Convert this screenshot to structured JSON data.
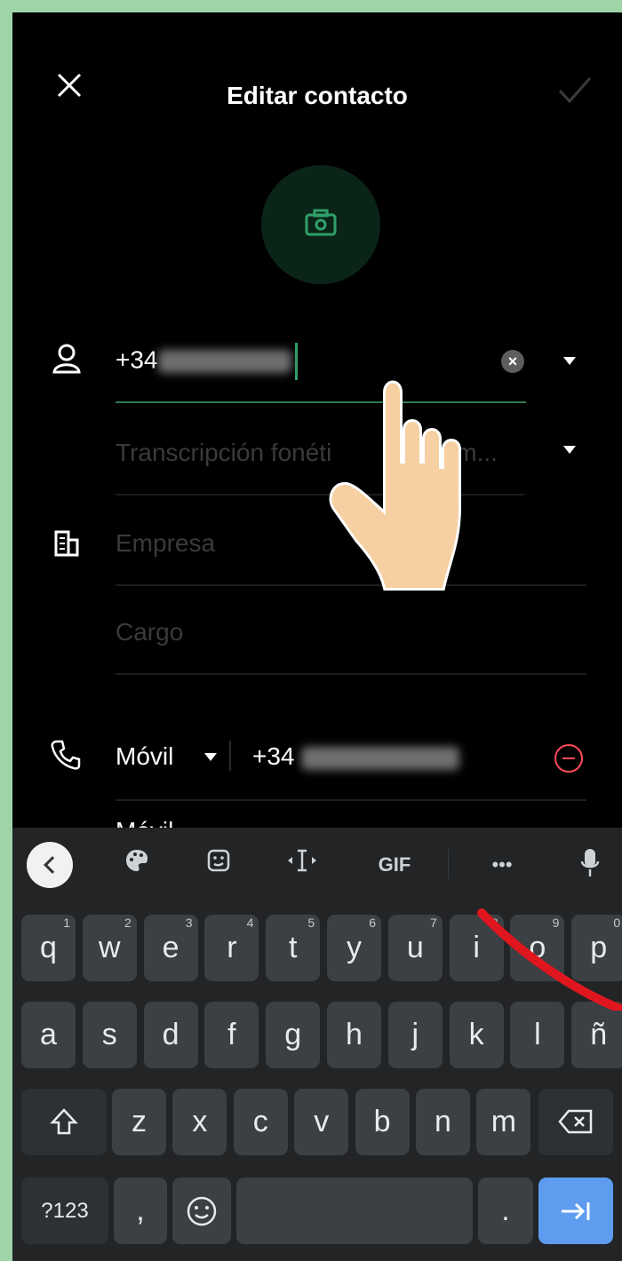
{
  "header": {
    "title": "Editar contacto"
  },
  "contact": {
    "name_prefix": "+34",
    "phonetic_placeholder": "Transcripción fonética del nombre",
    "phonetic_display": "Transcripción fonéti",
    "phonetic_tail": "m...",
    "company_placeholder": "Empresa",
    "job_placeholder": "Cargo",
    "phone_type": "Móvil",
    "phone_prefix": "+34",
    "next_row_label": "Móvil"
  },
  "keyboard": {
    "toolbar": {
      "gif": "GIF",
      "more": "•••"
    },
    "row1": [
      {
        "k": "q",
        "h": "1"
      },
      {
        "k": "w",
        "h": "2"
      },
      {
        "k": "e",
        "h": "3"
      },
      {
        "k": "r",
        "h": "4"
      },
      {
        "k": "t",
        "h": "5"
      },
      {
        "k": "y",
        "h": "6"
      },
      {
        "k": "u",
        "h": "7"
      },
      {
        "k": "i",
        "h": "8"
      },
      {
        "k": "o",
        "h": "9"
      },
      {
        "k": "p",
        "h": "0"
      }
    ],
    "row2": [
      "a",
      "s",
      "d",
      "f",
      "g",
      "h",
      "j",
      "k",
      "l",
      "ñ"
    ],
    "row3": [
      "z",
      "x",
      "c",
      "v",
      "b",
      "n",
      "m"
    ],
    "row4": {
      "sym": "?123",
      "comma": ",",
      "period": "."
    }
  },
  "colors": {
    "accent": "#2ea16a",
    "remove": "#ff4a5a",
    "enter_key": "#5e9cf0"
  }
}
